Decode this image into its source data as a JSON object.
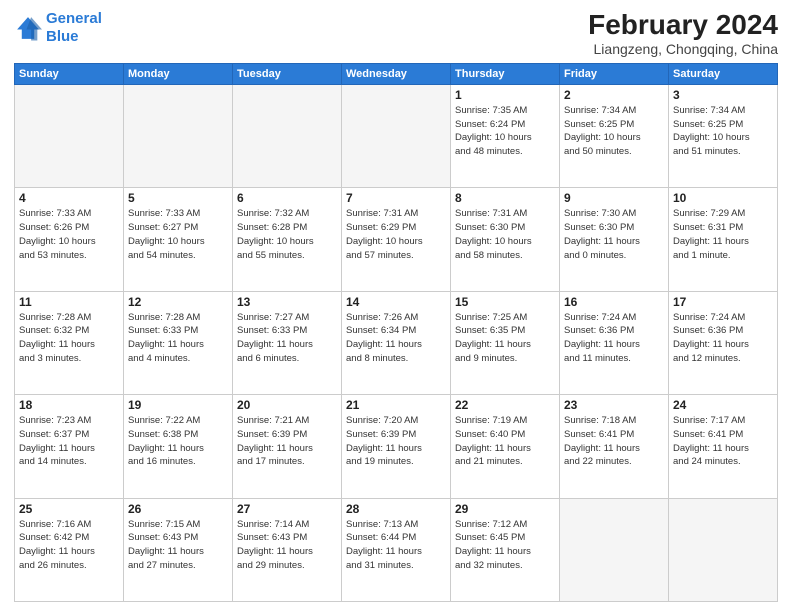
{
  "logo": {
    "line1": "General",
    "line2": "Blue"
  },
  "title": "February 2024",
  "subtitle": "Liangzeng, Chongqing, China",
  "days_header": [
    "Sunday",
    "Monday",
    "Tuesday",
    "Wednesday",
    "Thursday",
    "Friday",
    "Saturday"
  ],
  "weeks": [
    [
      {
        "day": "",
        "info": ""
      },
      {
        "day": "",
        "info": ""
      },
      {
        "day": "",
        "info": ""
      },
      {
        "day": "",
        "info": ""
      },
      {
        "day": "1",
        "info": "Sunrise: 7:35 AM\nSunset: 6:24 PM\nDaylight: 10 hours\nand 48 minutes."
      },
      {
        "day": "2",
        "info": "Sunrise: 7:34 AM\nSunset: 6:25 PM\nDaylight: 10 hours\nand 50 minutes."
      },
      {
        "day": "3",
        "info": "Sunrise: 7:34 AM\nSunset: 6:25 PM\nDaylight: 10 hours\nand 51 minutes."
      }
    ],
    [
      {
        "day": "4",
        "info": "Sunrise: 7:33 AM\nSunset: 6:26 PM\nDaylight: 10 hours\nand 53 minutes."
      },
      {
        "day": "5",
        "info": "Sunrise: 7:33 AM\nSunset: 6:27 PM\nDaylight: 10 hours\nand 54 minutes."
      },
      {
        "day": "6",
        "info": "Sunrise: 7:32 AM\nSunset: 6:28 PM\nDaylight: 10 hours\nand 55 minutes."
      },
      {
        "day": "7",
        "info": "Sunrise: 7:31 AM\nSunset: 6:29 PM\nDaylight: 10 hours\nand 57 minutes."
      },
      {
        "day": "8",
        "info": "Sunrise: 7:31 AM\nSunset: 6:30 PM\nDaylight: 10 hours\nand 58 minutes."
      },
      {
        "day": "9",
        "info": "Sunrise: 7:30 AM\nSunset: 6:30 PM\nDaylight: 11 hours\nand 0 minutes."
      },
      {
        "day": "10",
        "info": "Sunrise: 7:29 AM\nSunset: 6:31 PM\nDaylight: 11 hours\nand 1 minute."
      }
    ],
    [
      {
        "day": "11",
        "info": "Sunrise: 7:28 AM\nSunset: 6:32 PM\nDaylight: 11 hours\nand 3 minutes."
      },
      {
        "day": "12",
        "info": "Sunrise: 7:28 AM\nSunset: 6:33 PM\nDaylight: 11 hours\nand 4 minutes."
      },
      {
        "day": "13",
        "info": "Sunrise: 7:27 AM\nSunset: 6:33 PM\nDaylight: 11 hours\nand 6 minutes."
      },
      {
        "day": "14",
        "info": "Sunrise: 7:26 AM\nSunset: 6:34 PM\nDaylight: 11 hours\nand 8 minutes."
      },
      {
        "day": "15",
        "info": "Sunrise: 7:25 AM\nSunset: 6:35 PM\nDaylight: 11 hours\nand 9 minutes."
      },
      {
        "day": "16",
        "info": "Sunrise: 7:24 AM\nSunset: 6:36 PM\nDaylight: 11 hours\nand 11 minutes."
      },
      {
        "day": "17",
        "info": "Sunrise: 7:24 AM\nSunset: 6:36 PM\nDaylight: 11 hours\nand 12 minutes."
      }
    ],
    [
      {
        "day": "18",
        "info": "Sunrise: 7:23 AM\nSunset: 6:37 PM\nDaylight: 11 hours\nand 14 minutes."
      },
      {
        "day": "19",
        "info": "Sunrise: 7:22 AM\nSunset: 6:38 PM\nDaylight: 11 hours\nand 16 minutes."
      },
      {
        "day": "20",
        "info": "Sunrise: 7:21 AM\nSunset: 6:39 PM\nDaylight: 11 hours\nand 17 minutes."
      },
      {
        "day": "21",
        "info": "Sunrise: 7:20 AM\nSunset: 6:39 PM\nDaylight: 11 hours\nand 19 minutes."
      },
      {
        "day": "22",
        "info": "Sunrise: 7:19 AM\nSunset: 6:40 PM\nDaylight: 11 hours\nand 21 minutes."
      },
      {
        "day": "23",
        "info": "Sunrise: 7:18 AM\nSunset: 6:41 PM\nDaylight: 11 hours\nand 22 minutes."
      },
      {
        "day": "24",
        "info": "Sunrise: 7:17 AM\nSunset: 6:41 PM\nDaylight: 11 hours\nand 24 minutes."
      }
    ],
    [
      {
        "day": "25",
        "info": "Sunrise: 7:16 AM\nSunset: 6:42 PM\nDaylight: 11 hours\nand 26 minutes."
      },
      {
        "day": "26",
        "info": "Sunrise: 7:15 AM\nSunset: 6:43 PM\nDaylight: 11 hours\nand 27 minutes."
      },
      {
        "day": "27",
        "info": "Sunrise: 7:14 AM\nSunset: 6:43 PM\nDaylight: 11 hours\nand 29 minutes."
      },
      {
        "day": "28",
        "info": "Sunrise: 7:13 AM\nSunset: 6:44 PM\nDaylight: 11 hours\nand 31 minutes."
      },
      {
        "day": "29",
        "info": "Sunrise: 7:12 AM\nSunset: 6:45 PM\nDaylight: 11 hours\nand 32 minutes."
      },
      {
        "day": "",
        "info": ""
      },
      {
        "day": "",
        "info": ""
      }
    ]
  ]
}
